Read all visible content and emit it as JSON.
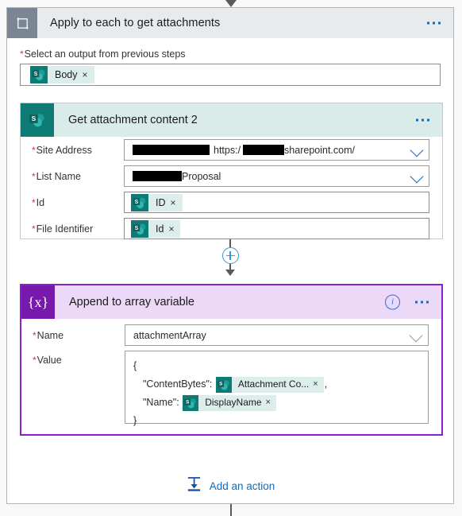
{
  "scope": {
    "title": "Apply to each to get attachments",
    "icon": "loop-icon",
    "menu": "more-options",
    "foreach": {
      "label": "Select an output from previous steps",
      "required_mark": "*",
      "token": {
        "label": "Body",
        "remove": "×",
        "icon": "sharepoint-icon"
      }
    }
  },
  "actions": [
    {
      "id": "get-attachment-content",
      "title": "Get attachment content 2",
      "icon": "sharepoint-icon",
      "accent": "#0f7b77",
      "header_bg": "#d9ecea",
      "fields": [
        {
          "label": "Site Address",
          "required_mark": "*",
          "type": "dropdown",
          "redacted_prefix_width": 97,
          "text_middle": "https:/",
          "redacted_mid_width": 52,
          "text_suffix": "sharepoint.com/",
          "chevron": "chevron-down-icon"
        },
        {
          "label": "List Name",
          "required_mark": "*",
          "type": "dropdown",
          "redacted_prefix_width": 62,
          "text_suffix": "Proposal",
          "chevron": "chevron-down-icon"
        },
        {
          "label": "Id",
          "required_mark": "*",
          "type": "token",
          "token": {
            "label": "ID",
            "remove": "×",
            "icon": "sharepoint-icon"
          }
        },
        {
          "label": "File Identifier",
          "required_mark": "*",
          "type": "token",
          "token": {
            "label": "Id",
            "remove": "×",
            "icon": "sharepoint-icon"
          }
        }
      ]
    }
  ],
  "connector": {
    "add_step": "+",
    "icon": "add-step-icon"
  },
  "append_card": {
    "title": "Append to array variable",
    "icon": "variable-icon",
    "icon_glyph": "{x}",
    "accent": "#7719aa",
    "header_bg": "#ecd9f7",
    "selected_border": "#8a1fd0",
    "info": "i",
    "menu": "more-options",
    "name_field": {
      "label": "Name",
      "required_mark": "*",
      "value": "attachmentArray",
      "chevron": "chevron-down-icon"
    },
    "value_field": {
      "label": "Value",
      "required_mark": "*",
      "line_open": "{",
      "key_contentbytes": "\"ContentBytes\":",
      "token_contentbytes": {
        "label": "Attachment Co...",
        "remove": "×",
        "icon": "sharepoint-icon"
      },
      "comma": ",",
      "key_name": "\"Name\":",
      "token_name": {
        "label": "DisplayName",
        "remove": "×",
        "icon": "sharepoint-icon"
      },
      "line_close": "}"
    }
  },
  "add_action": {
    "label": "Add an action",
    "icon": "add-action-icon"
  }
}
